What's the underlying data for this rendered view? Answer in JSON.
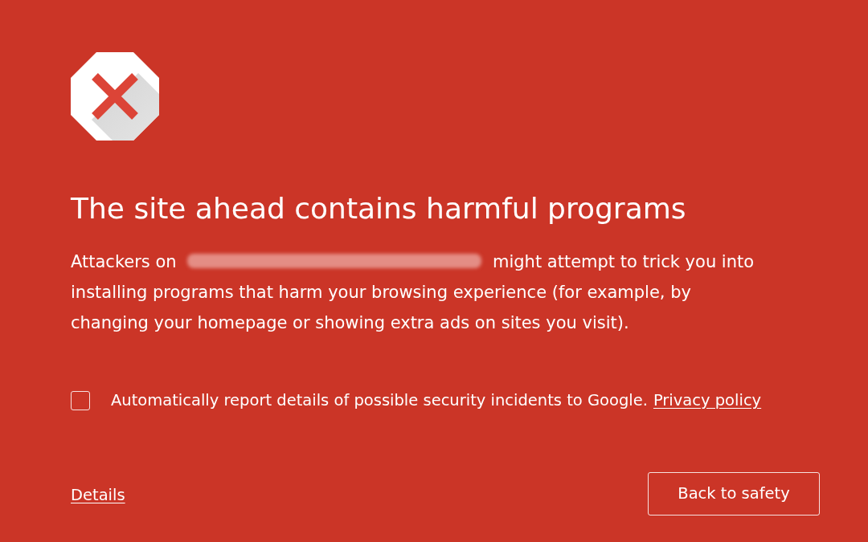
{
  "heading": "The site ahead contains harmful programs",
  "message": {
    "before": "Attackers on",
    "after": "might attempt to trick you into installing programs that harm your browsing experience (for example, by changing your homepage or showing extra ads on sites you visit)."
  },
  "report_option": {
    "label": "Automatically report details of possible security incidents to Google.",
    "link": "Privacy policy",
    "checked": false
  },
  "details_link": "Details",
  "primary_button": "Back to safety"
}
